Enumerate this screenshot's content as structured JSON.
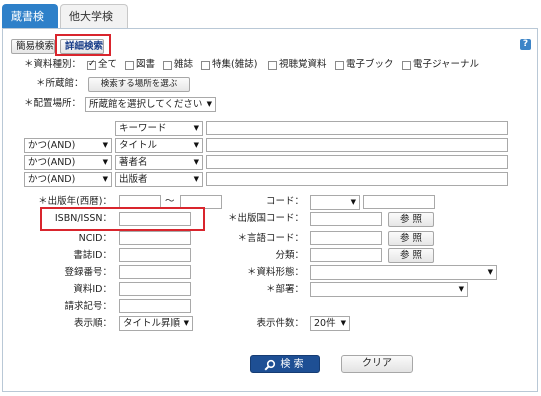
{
  "tabs": [
    {
      "label": "蔵書検索",
      "active": true
    },
    {
      "label": "他大学検索",
      "active": false
    }
  ],
  "mode_buttons": {
    "simple": "簡易検索",
    "detail": "詳細検索"
  },
  "help_icon": "?",
  "material_type": {
    "label": "＊資料種別：",
    "options": [
      {
        "label": "全て",
        "checked": true
      },
      {
        "label": "図書",
        "checked": false
      },
      {
        "label": "雑誌",
        "checked": false
      },
      {
        "label": "特集(雑誌)",
        "checked": false
      },
      {
        "label": "視聴覚資料",
        "checked": false
      },
      {
        "label": "電子ブック",
        "checked": false
      },
      {
        "label": "電子ジャーナル",
        "checked": false
      }
    ]
  },
  "location": {
    "label": "＊所蔵館：",
    "button": "検索する場所を選ぶ"
  },
  "shelf": {
    "label": "＊配置場所：",
    "value": "所蔵館を選択してください"
  },
  "keyword_rows": [
    {
      "op": "",
      "field": "キーワード"
    },
    {
      "op": "かつ(AND)",
      "field": "タイトル"
    },
    {
      "op": "かつ(AND)",
      "field": "著者名"
    },
    {
      "op": "かつ(AND)",
      "field": "出版者"
    }
  ],
  "left_fields": {
    "pub_year": "＊出版年(西暦)：",
    "tilde": "～",
    "isbn": "ISBN/ISSN：",
    "ncid": "NCID：",
    "bib_id": "書誌ID：",
    "reg_no": "登録番号：",
    "material_id": "資料ID：",
    "call_no": "請求記号：",
    "sort_label": "表示順：",
    "sort_value": "タイトル昇順"
  },
  "right_fields": {
    "code": "コード：",
    "country": "＊出版国コード：",
    "language": "＊言語コード：",
    "classification": "分類：",
    "form": "＊資料形態：",
    "department": "＊部署：",
    "count_label": "表示件数：",
    "count_value": "20件",
    "browse": "参 照"
  },
  "actions": {
    "search": "検 索",
    "clear": "クリア"
  },
  "colors": {
    "active_tab": "#2e80c9",
    "search_button": "#1e4f94",
    "highlight": "#d9252d"
  }
}
